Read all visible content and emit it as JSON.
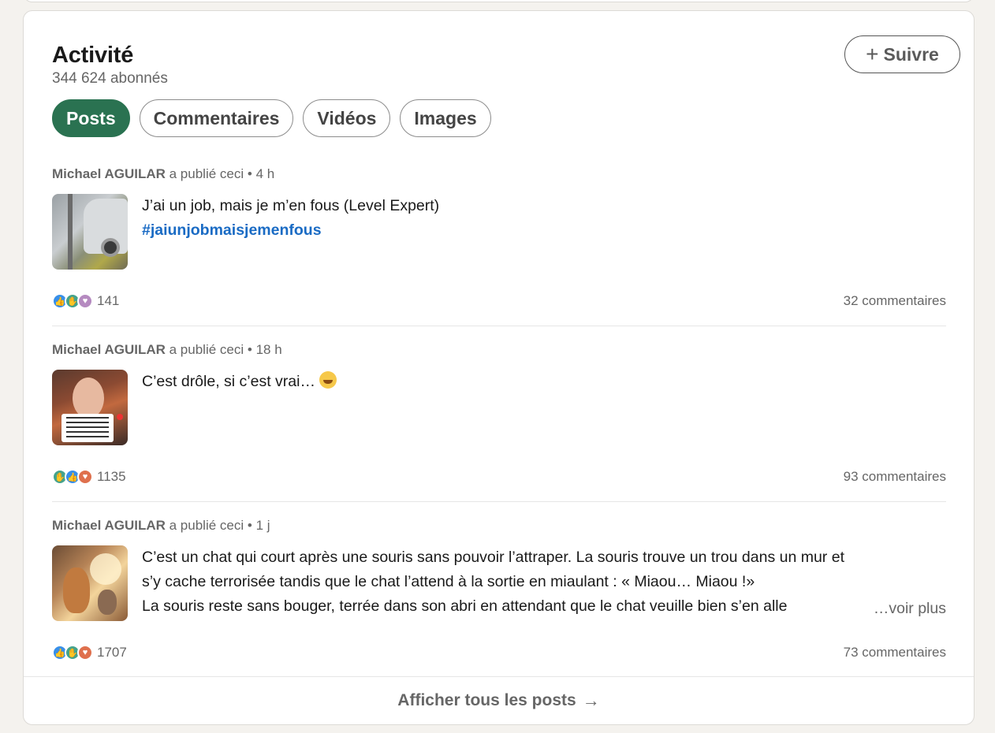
{
  "activity": {
    "title": "Activité",
    "followers": "344 624 abonnés",
    "follow_button": "Suivre"
  },
  "tabs": [
    {
      "label": "Posts",
      "active": true
    },
    {
      "label": "Commentaires",
      "active": false
    },
    {
      "label": "Vidéos",
      "active": false
    },
    {
      "label": "Images",
      "active": false
    }
  ],
  "posts": [
    {
      "author": "Michael AGUILAR",
      "action": "a publié ceci",
      "time": "4 h",
      "text_line1": "J’ai un job, mais je m’en fous (Level Expert)",
      "hashtag": "#jaiunjobmaisjemenfous",
      "reactions": [
        "like",
        "celebrate",
        "support"
      ],
      "reaction_count": "141",
      "comments": "32 commentaires"
    },
    {
      "author": "Michael AGUILAR",
      "action": "a publié ceci",
      "time": "18 h",
      "text_line1": "C’est drôle, si c’est vrai…",
      "emoji": "rolling-on-floor-laughing",
      "reactions": [
        "celebrate",
        "like",
        "love"
      ],
      "reaction_count": "1135",
      "comments": "93 commentaires"
    },
    {
      "author": "Michael AGUILAR",
      "action": "a publié ceci",
      "time": "1 j",
      "text_line1": "C’est un chat qui court après une souris sans pouvoir l’attraper. La souris trouve un trou dans un mur et",
      "text_line2": "s’y cache terrorisée tandis que le chat l’attend à la sortie en miaulant : « Miaou… Miaou !»",
      "text_line3": "La souris reste sans bouger, terrée dans son abri en attendant que le chat veuille bien s’en alle",
      "see_more": "…voir plus",
      "reactions": [
        "like",
        "celebrate",
        "love"
      ],
      "reaction_count": "1707",
      "comments": "73 commentaires"
    }
  ],
  "footer": {
    "label": "Afficher tous les posts"
  },
  "colors": {
    "active_tab": "#2a7251",
    "hashtag": "#1a6bc4",
    "like": "#378fe9",
    "celebrate": "#44a38c",
    "support": "#b58ac0",
    "love": "#df704d"
  }
}
